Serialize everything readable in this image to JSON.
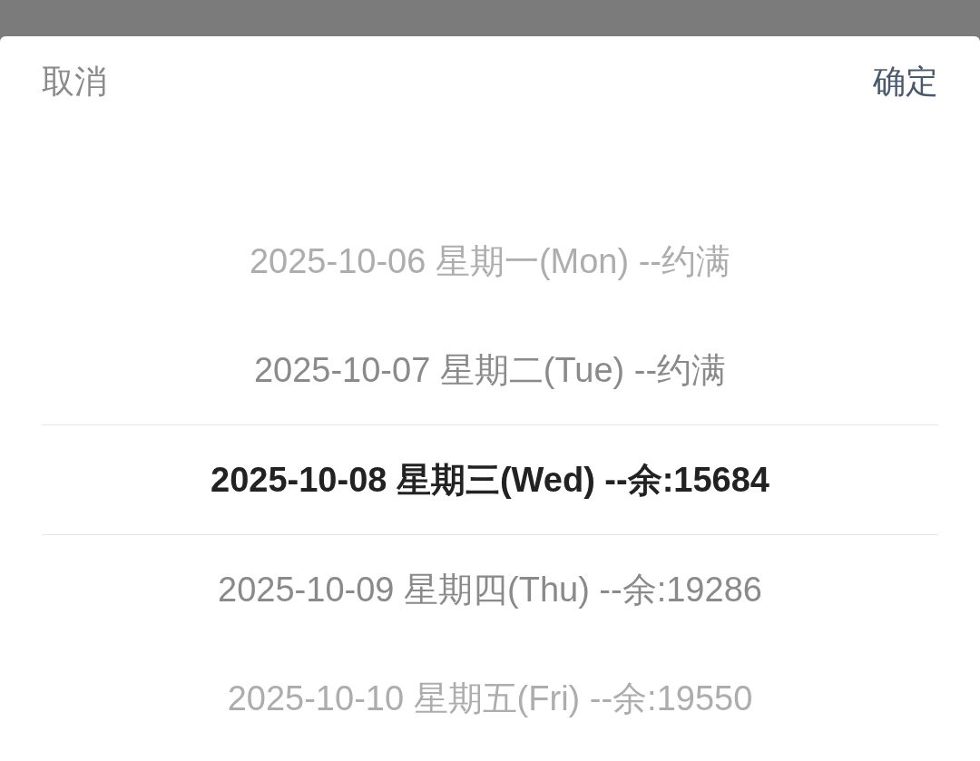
{
  "header": {
    "cancel": "取消",
    "confirm": "确定"
  },
  "dates": [
    {
      "label": "2025-10-06 星期一(Mon) --约满",
      "selected": false
    },
    {
      "label": "2025-10-07 星期二(Tue) --约满",
      "selected": false
    },
    {
      "label": "2025-10-08 星期三(Wed) --余:15684",
      "selected": true
    },
    {
      "label": "2025-10-09 星期四(Thu) --余:19286",
      "selected": false
    },
    {
      "label": "2025-10-10 星期五(Fri) --余:19550",
      "selected": false
    }
  ]
}
